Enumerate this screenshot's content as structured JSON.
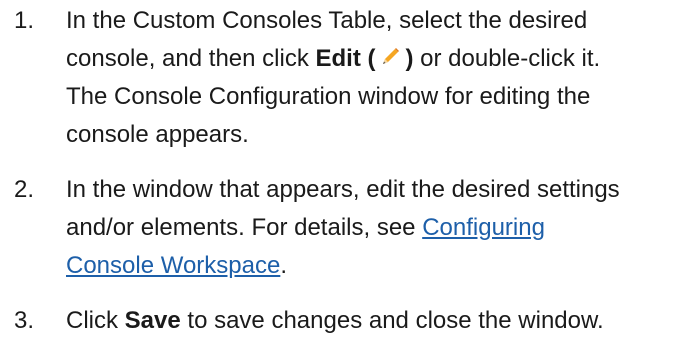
{
  "steps": [
    {
      "number": "1.",
      "line1": "In the Custom Consoles Table, select the desired",
      "line2_pre": "console, and then click ",
      "edit_bold_open": "Edit (",
      "edit_bold_close": ")",
      "line2_post": " or double-click it.",
      "line3": "The Console Configuration window for editing the",
      "line4": "console appears."
    },
    {
      "number": "2.",
      "line1": "In the window that appears, edit the desired settings",
      "line2_pre": "and/or elements. For details, see ",
      "link_part1": "Configuring",
      "link_part2": "Console Workspace",
      "line3_post": "."
    },
    {
      "number": "3.",
      "pre": "Click ",
      "save_bold": "Save",
      "post": " to save changes and close the window."
    }
  ],
  "icons": {
    "edit": "pencil-icon"
  },
  "colors": {
    "text": "#1a1a1a",
    "link": "#1d5fa9",
    "pencil_body": "#f5a623"
  }
}
